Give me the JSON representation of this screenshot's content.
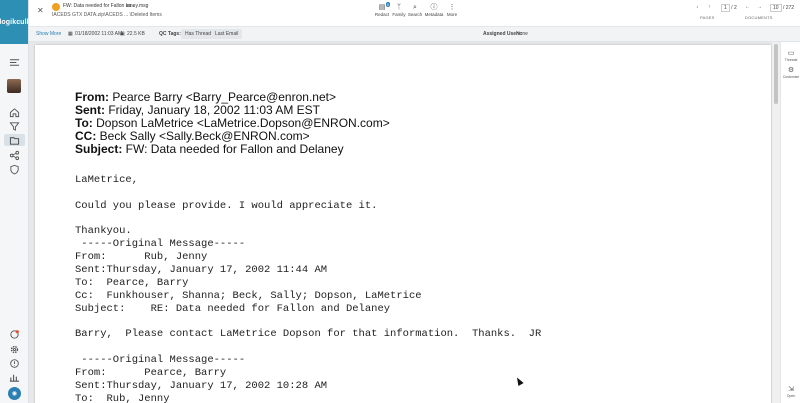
{
  "brand": "logikcull",
  "header": {
    "tab_title": "FW: Data needed for Fallon an...",
    "file_name": "laney.msg",
    "tab_subtitle": "IACEDS GTX DATA.zip\\ACEDS ... \\Deleted Items",
    "toolbar": [
      {
        "label": "Redact",
        "icon": "redact-icon",
        "badge": "0"
      },
      {
        "label": "Family",
        "icon": "family-icon"
      },
      {
        "label": "Search",
        "icon": "search-icon"
      },
      {
        "label": "Metadata",
        "icon": "metadata-icon"
      },
      {
        "label": "More",
        "icon": "more-icon"
      }
    ],
    "pages": {
      "current": "1",
      "total": "/ 2",
      "label": "PAGES"
    },
    "documents": {
      "current": "10",
      "total": "/ 272",
      "label": "DOCUMENTS"
    }
  },
  "subbar": {
    "show_more": "Show More",
    "date": "01/18/2002 11:03 AM",
    "size": "22.5 KB",
    "qc_tags_label": "QC Tags:",
    "tags": [
      "Has Threads",
      "Last Email"
    ],
    "assigned_users_label": "Assigned Users:",
    "assigned_users_value": "None"
  },
  "rightrail": {
    "threads": "Threads",
    "customize": "Customize",
    "open": "Open"
  },
  "document": {
    "header_lines": [
      {
        "label": "From:",
        "value": " Pearce Barry <Barry_Pearce@enron.net>"
      },
      {
        "label": "Sent:",
        "value": " Friday, January 18, 2002 11:03 AM EST"
      },
      {
        "label": "To:",
        "value": " Dopson LaMetrice <LaMetrice.Dopson@ENRON.com>"
      },
      {
        "label": "CC:",
        "value": " Beck Sally <Sally.Beck@ENRON.com>"
      },
      {
        "label": "Subject:",
        "value": " FW: Data needed for Fallon and Delaney"
      }
    ],
    "body_lines": [
      "LaMetrice,",
      "Could you please provide. I would appreciate it.",
      "Thankyou.",
      " -----Original Message-----",
      "From:      Rub, Jenny",
      "Sent:Thursday, January 17, 2002 11:44 AM",
      "To:  Pearce, Barry",
      "Cc:  Funkhouser, Shanna; Beck, Sally; Dopson, LaMetrice",
      "Subject:    RE: Data needed for Fallon and Delaney",
      "Barry,  Please contact LaMetrice Dopson for that information.  Thanks.  JR",
      " -----Original Message-----",
      "From:      Pearce, Barry",
      "Sent:Thursday, January 17, 2002 10:28 AM",
      "To:  Rub, Jenny"
    ]
  },
  "colors": {
    "brand": "#2c8fb3",
    "accent": "#2c7fb3"
  }
}
